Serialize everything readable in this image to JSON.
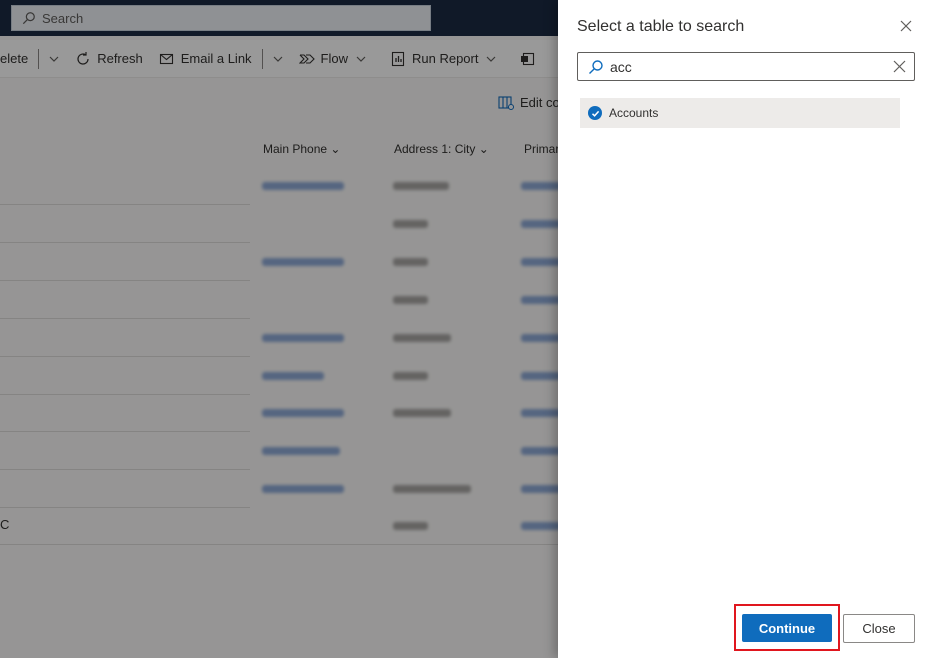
{
  "topbar": {
    "search_placeholder": "Search",
    "search_icon": "search-icon"
  },
  "commandbar": {
    "delete_label": "elete",
    "refresh_label": "Refresh",
    "email_label": "Email a Link",
    "flow_label": "Flow",
    "run_report_label": "Run Report",
    "edit_columns_label": "Edit co"
  },
  "grid": {
    "columns": [
      "Main Phone",
      "Address 1: City",
      "Primar"
    ],
    "last_row_stub": "C",
    "row_count": 10
  },
  "panel": {
    "title": "Select a table to search",
    "search_value": "acc",
    "result_label": "Accounts",
    "continue_label": "Continue",
    "close_label": "Close",
    "accent_color": "#0f6cbd",
    "highlight_color": "#e0161e"
  }
}
